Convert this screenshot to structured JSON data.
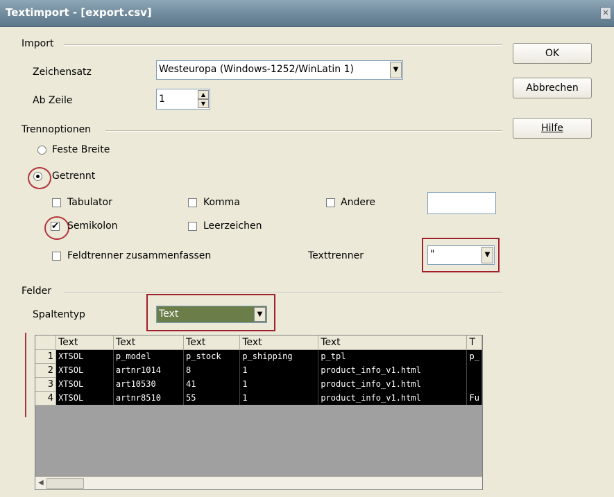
{
  "window": {
    "title": "Textimport - [export.csv]"
  },
  "buttons": {
    "ok": "OK",
    "cancel": "Abbrechen",
    "help": "Hilfe"
  },
  "import": {
    "section_label": "Import",
    "charset_label": "Zeichensatz",
    "charset_value": "Westeuropa (Windows-1252/WinLatin 1)",
    "start_row_label": "Ab Zeile",
    "start_row_value": "1"
  },
  "separator_options": {
    "section_label": "Trennoptionen",
    "fixed_width_label": "Feste Breite",
    "fixed_width_selected": false,
    "separated_label": "Getrennt",
    "separated_selected": true,
    "tab_label": "Tabulator",
    "tab_checked": false,
    "comma_label": "Komma",
    "comma_checked": false,
    "other_label": "Andere",
    "other_checked": false,
    "other_value": "",
    "semicolon_label": "Semikolon",
    "semicolon_checked": true,
    "space_label": "Leerzeichen",
    "space_checked": false,
    "merge_label": "Feldtrenner zusammenfassen",
    "merge_checked": false,
    "text_delimiter_label": "Texttrenner",
    "text_delimiter_value": "\""
  },
  "fields": {
    "section_label": "Felder",
    "column_type_label": "Spaltentyp",
    "column_type_value": "Text"
  },
  "preview": {
    "headers": [
      "Text",
      "Text",
      "Text",
      "Text",
      "Text",
      "T"
    ],
    "rows": [
      {
        "num": "1",
        "cells": [
          "XTSOL",
          "p_model",
          "p_stock",
          "p_shipping",
          "p_tpl",
          "p_"
        ]
      },
      {
        "num": "2",
        "cells": [
          "XTSOL",
          "artnr1014",
          "8",
          "1",
          "product_info_v1.html",
          ""
        ]
      },
      {
        "num": "3",
        "cells": [
          "XTSOL",
          "art10530",
          "41",
          "1",
          "product_info_v1.html",
          ""
        ]
      },
      {
        "num": "4",
        "cells": [
          "XTSOL",
          "artnr8510",
          "55",
          "1",
          "product_info_v1.html",
          "Fu"
        ]
      }
    ]
  },
  "colors": {
    "highlight": "#a02029",
    "title_bar": "#6f8a9c",
    "dialog_bg": "#ece9d8",
    "selection_bg": "#000000"
  }
}
